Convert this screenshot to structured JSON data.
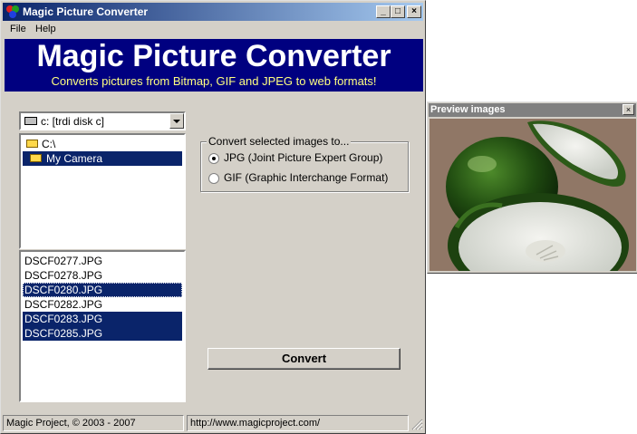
{
  "window": {
    "title": "Magic Picture Converter",
    "controls": {
      "minimize": "_",
      "maximize": "□",
      "close": "×"
    }
  },
  "menu": [
    "File",
    "Help"
  ],
  "banner": {
    "title": "Magic Picture Converter",
    "subtitle": "Converts pictures from Bitmap, GIF and JPEG to web formats!"
  },
  "drive": {
    "value": "c: [trdi disk c]",
    "icon": "drive-icon"
  },
  "folders": [
    {
      "label": "C:\\",
      "selected": false
    },
    {
      "label": "My Camera",
      "selected": true
    }
  ],
  "files": [
    {
      "name": "DSCF0277.JPG",
      "selected": false
    },
    {
      "name": "DSCF0278.JPG",
      "selected": false
    },
    {
      "name": "DSCF0280.JPG",
      "selected": true
    },
    {
      "name": "DSCF0282.JPG",
      "selected": false
    },
    {
      "name": "DSCF0283.JPG",
      "selected": true
    },
    {
      "name": "DSCF0285.JPG",
      "selected": true
    }
  ],
  "convert_group": {
    "legend": "Convert selected images to...",
    "options": [
      {
        "label": "JPG (Joint Picture Expert Group)",
        "checked": true
      },
      {
        "label": "GIF (Graphic Interchange Format)",
        "checked": false
      }
    ]
  },
  "convert_button": "Convert",
  "status": {
    "left": "Magic Project, © 2003 - 2007",
    "right": "http://www.magicproject.com/"
  },
  "preview": {
    "title": "Preview images",
    "close": "×"
  },
  "colors": {
    "title_gradient_start": "#0a246a",
    "banner_bg": "#000080",
    "selection": "#0a246a"
  }
}
